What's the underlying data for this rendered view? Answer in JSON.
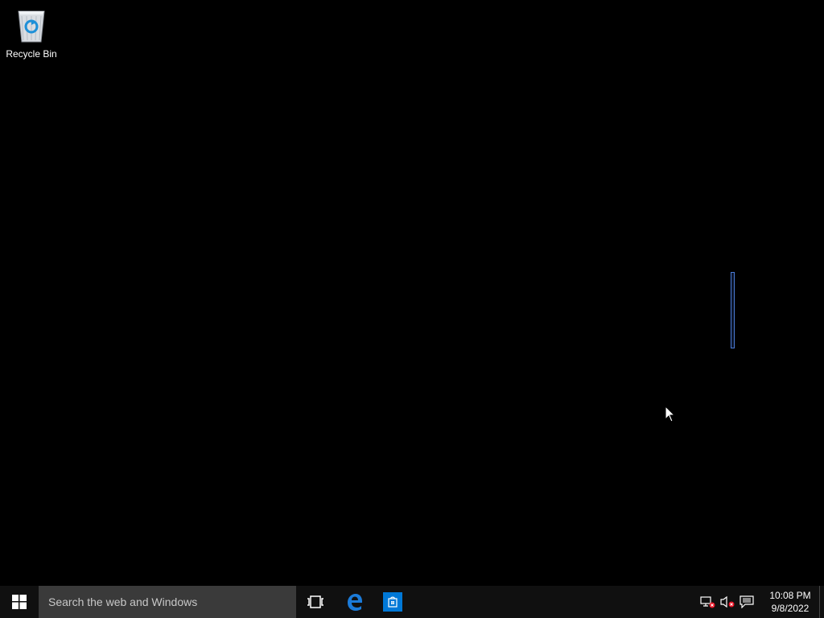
{
  "desktop": {
    "icons": [
      {
        "label": "Recycle Bin",
        "icon": "recycle-bin-icon"
      }
    ]
  },
  "taskbar": {
    "start_icon": "windows-logo-icon",
    "search_placeholder": "Search the web and Windows",
    "pinned": [
      {
        "icon": "task-view-icon"
      },
      {
        "icon": "edge-icon",
        "color": "#1b7bd9"
      },
      {
        "icon": "store-icon",
        "color": "#0078d7"
      }
    ],
    "tray": {
      "icons": [
        "network-disconnected-icon",
        "volume-muted-icon",
        "action-center-icon"
      ],
      "time": "10:08 PM",
      "date": "9/8/2022"
    }
  },
  "colors": {
    "desktop_bg": "#000000",
    "taskbar_bg": "#101010",
    "search_bg": "#3a3a3a",
    "accent": "#0078d7"
  }
}
